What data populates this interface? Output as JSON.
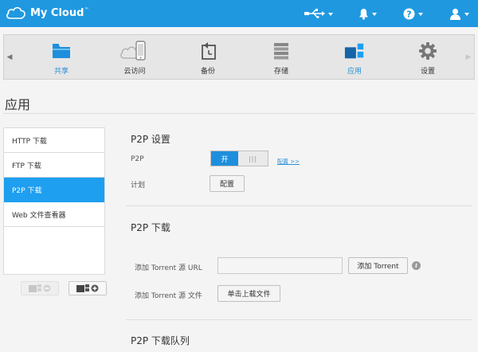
{
  "header": {
    "app_name": "My Cloud",
    "trademark": "™",
    "icons": [
      "cloud-logo-icon",
      "usb-icon",
      "bell-icon",
      "help-icon",
      "user-icon"
    ]
  },
  "nav": {
    "items": [
      {
        "label": "共享",
        "icon": "folder-icon",
        "active": true
      },
      {
        "label": "云访问",
        "icon": "cloud-device-icon",
        "active": false
      },
      {
        "label": "备份",
        "icon": "backup-icon",
        "active": false
      },
      {
        "label": "存储",
        "icon": "storage-icon",
        "active": false
      },
      {
        "label": "应用",
        "icon": "apps-icon",
        "active": true
      },
      {
        "label": "设置",
        "icon": "gear-icon",
        "active": false
      }
    ]
  },
  "page": {
    "title": "应用"
  },
  "sidebar": {
    "items": [
      {
        "label": "HTTP 下载",
        "active": false
      },
      {
        "label": "FTP 下载",
        "active": false
      },
      {
        "label": "P2P 下载",
        "active": true
      },
      {
        "label": "Web 文件查看器",
        "active": false
      }
    ]
  },
  "p2p_settings": {
    "title": "P2P 设置",
    "p2p_label": "P2P",
    "toggle_on": "开",
    "toggle_off": "|||",
    "config_link": "配置 >>",
    "schedule_label": "计划",
    "schedule_button": "配置"
  },
  "p2p_download": {
    "title": "P2P 下载",
    "url_label": "添加 Torrent 源 URL",
    "url_value": "",
    "add_button": "添加 Torrent",
    "file_label": "添加 Torrent 源 文件",
    "upload_button": "单击上载文件"
  },
  "queue": {
    "title": "P2P 下载队列"
  },
  "colors": {
    "topbar": "#1f98e0",
    "accent": "#1e9ff0",
    "toggle_on": "#1e8fdc",
    "link": "#2b8fd6"
  }
}
